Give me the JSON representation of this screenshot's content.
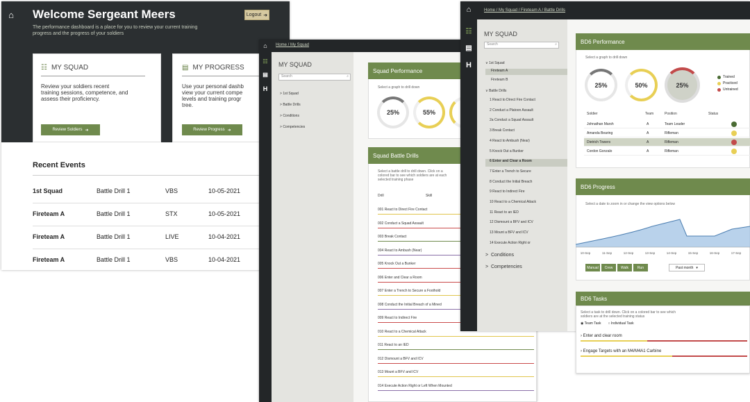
{
  "win1": {
    "title": "Welcome Sergeant Meers",
    "subtitle_line1": "The performance dashboard is a place for you to review your current training",
    "subtitle_line2": "progress and the progress of your soldiers",
    "logout_label": "Logout",
    "squad_card": {
      "title": "MY SQUAD",
      "text_line1": "Review your soldiers recent",
      "text_line2": "training sessions, competence, and",
      "text_line3": "assess their proficiency.",
      "button": "Review Soldiers"
    },
    "progress_card": {
      "title": "MY PROGRESS",
      "text_line1": "Use your personal dashb",
      "text_line2": "view your current compe",
      "text_line3": "levels and training progr",
      "text_line4": "tree.",
      "button": "Review Progress"
    },
    "recent_title": "Recent Events",
    "events": [
      {
        "unit": "1st Squad",
        "drill": "Battle Drill 1",
        "type": "VBS",
        "date": "10-05-2021"
      },
      {
        "unit": "Fireteam A",
        "drill": "Battle Drill 1",
        "type": "STX",
        "date": "10-05-2021"
      },
      {
        "unit": "Fireteam A",
        "drill": "Battle Drill 1",
        "type": "LIVE",
        "date": "10-04-2021"
      },
      {
        "unit": "Fireteam A",
        "drill": "Battle Drill 1",
        "type": "VBS",
        "date": "10-04-2021"
      }
    ]
  },
  "win2": {
    "breadcrumb": "Home / My Squad",
    "sidebar_title": "MY SQUAD",
    "search_placeholder": "Search",
    "nav": [
      "1st Squad",
      "Battle Drills",
      "Conditions",
      "Competencies"
    ],
    "perf_title": "Squad Performance",
    "perf_hint": "Select a graph to drill down",
    "rings": [
      "25%",
      "55%"
    ],
    "drills_title": "Squad Battle Drills",
    "drills_hint_line1": "Select a battle drill to drill down. Click on a",
    "drills_hint_line2": "colored bar to see which soldiers are at each",
    "drills_hint_line3": "selected training phase",
    "col1": "Drill",
    "col2": "Skill",
    "drills": [
      "001 React to Direct Fire Contact",
      "002 Conduct a Squad Assault",
      "003 Break Contact",
      "004 React to Ambush (Near)",
      "005 Knock Out a Bunker",
      "006 Enter and Clear a Room",
      "007 Enter a Trench to Secure a Foothold",
      "008 Conduct the Initial Breach of a Mined",
      "009 React to Indirect Fire",
      "010 React to a Chemical Attack",
      "011 React to an IED",
      "012 Dismount a BFV and ICV",
      "013 Mount a BFV and ICV",
      "014 Execute Action Right or Left When Mounted"
    ],
    "drill_colors": [
      "#e0c54b",
      "#c94a4a",
      "#6f8a4d",
      "#8a6fa8",
      "#c94a4a",
      "#c94a4a",
      "#e0c54b",
      "#8a6fa8",
      "#c94a4a",
      "#e0c54b",
      "#6f8a4d",
      "#c94a4a",
      "#e0c54b",
      "#8a6fa8"
    ]
  },
  "win3": {
    "breadcrumb": "Home / My Squad / Fireteam A / Battle Drills",
    "sidebar_title": "MY SQUAD",
    "search_placeholder": "Search",
    "squad": "1st Squad",
    "teams": [
      "Fireteam A",
      "Fireteam B"
    ],
    "drills_header": "Battle Drills",
    "drills": [
      "1 React to Direct Fire Contact",
      "2 Conduct a Platoon Assault",
      "2a Conduct a Squad Assault",
      "3 Break Contact",
      "4 React to Ambush (Near)",
      "5 Knock Out a Bunker",
      "6 Enter and Clear a Room",
      "7 Enter a Trench to Secure",
      "8 Conduct the Initial Breach",
      "9 React to Indirect Fire",
      "10 React to a Chemical Attack",
      "11 React to an IED",
      "12 Dismount a BFV and ICV",
      "13 Mount a BFV and ICV",
      "14 Execute Action Right or"
    ],
    "conditions": "Conditions",
    "competencies": "Competencies",
    "perf_title": "BD6 Performance",
    "perf_hint": "Select a graph to drill down",
    "rings": [
      "25%",
      "50%",
      "25%"
    ],
    "legend": [
      "Trained",
      "Practiced",
      "Untrained"
    ],
    "legend_colors": [
      "#4a6b33",
      "#e8cf55",
      "#c24a4a"
    ],
    "table_headers": [
      "Soldier",
      "Team",
      "Position",
      "Status"
    ],
    "soldiers": [
      {
        "name": "Johnathan Marsh",
        "team": "A",
        "position": "Team Leader",
        "status_color": "#4a6b33"
      },
      {
        "name": "Amanda Bearing",
        "team": "A",
        "position": "Rifleman",
        "status_color": "#e8cf55"
      },
      {
        "name": "Dietrich Towers",
        "team": "A",
        "position": "Rifleman",
        "status_color": "#c24a4a"
      },
      {
        "name": "Cordon Gonzalo",
        "team": "A",
        "position": "Rifleman",
        "status_color": "#e8cf55"
      }
    ],
    "progress_title": "BD6 Progress",
    "progress_hint": "Select a date to zoom in or change the view options below",
    "x_ticks": [
      "10-Sep",
      "11-Sep",
      "12-Sep",
      "13-Sep",
      "14-Sep",
      "15-Sep",
      "16-Sep",
      "17-Sep"
    ],
    "view_buttons": [
      "Manual",
      "Crew",
      "Walk",
      "Run"
    ],
    "range_select": "Past month",
    "tasks_title": "BD6 Tasks",
    "tasks_hint_line1": "Select a task to drill down. Click on a colored bar to see which",
    "tasks_hint_line2": "soldiers are at the selected training status",
    "tasks_filters": [
      "Team Task",
      "Individual Task"
    ],
    "tasks": [
      "Enter and clear room",
      "Engage Targets with an M4/M4A1 Carbine"
    ]
  }
}
